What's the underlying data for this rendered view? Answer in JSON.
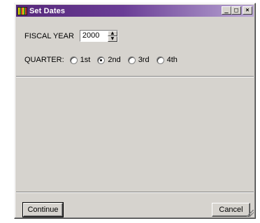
{
  "window": {
    "title": "Set Dates",
    "minimize_glyph": "_",
    "maximize_glyph": "□",
    "close_glyph": "×",
    "titlebar_color": "#56287a"
  },
  "fiscal_year": {
    "label": "FISCAL YEAR",
    "value": "2000"
  },
  "quarter": {
    "label": "QUARTER:",
    "options": [
      "1st",
      "2nd",
      "3rd",
      "4th"
    ],
    "selected": "2nd"
  },
  "buttons": {
    "continue_label": "Continue",
    "cancel_label": "Cancel"
  }
}
